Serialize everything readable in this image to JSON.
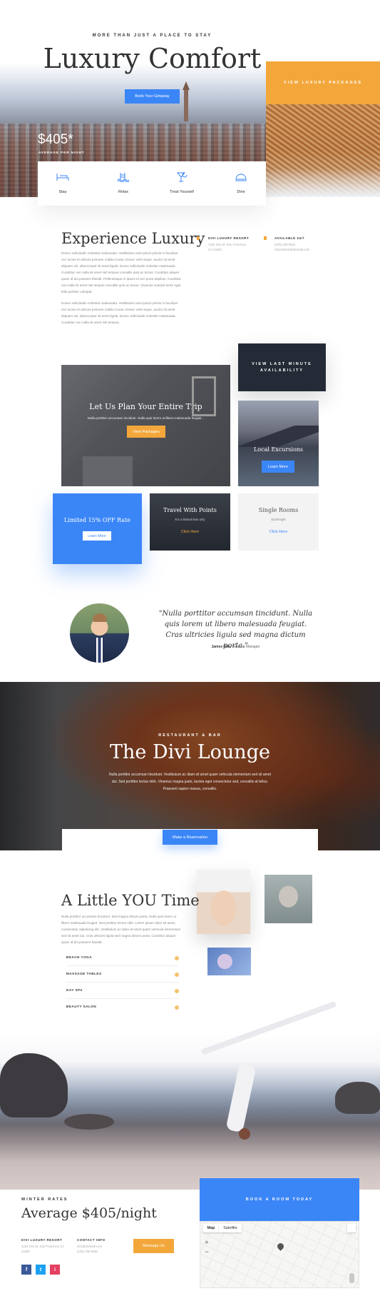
{
  "hero": {
    "eyebrow": "MORE THAN JUST A PLACE TO STAY",
    "title": "Luxury Comfort",
    "cta": "Book Your Getaway",
    "side_button": "VIEW LUXURY PACKAGES",
    "price": "$405*",
    "price_note": "AVERAGE PER NIGHT"
  },
  "amenities": [
    {
      "label": "Stay",
      "icon": "bed-icon"
    },
    {
      "label": "Relax",
      "icon": "pool-icon"
    },
    {
      "label": "Treat Yourself",
      "icon": "cocktail-icon"
    },
    {
      "label": "Dine",
      "icon": "cloche-icon"
    }
  ],
  "experience": {
    "title": "Experience Luxury",
    "para1": "Donec sollicitudin molestie malesuada. Vestibulum ante ipsum primis in faucibus orci luctus et ultrices posuere cubilia Curae; Donec velit neque, auctor sit amet aliquam vel, ullamcorper sit amet ligula. Donec sollicitudin molestie malesuada. Curabitur non nulla sit amet nisl tempus convallis quis ac lectus. Curabitur aliquet quam id dui posuere blandit. Pellentesque in ipsum id orci porta dapibus. Curabitur non nulla sit amet nisl tempus convallis quis ac lectus. Vivamus suscipit tortor eget felis porttitor volutpat.",
    "para2": "Donec sollicitudin molestie malesuada. Vestibulum ante ipsum primis in faucibus orci luctus et ultrices posuere cubilia Curae; Donec velit neque, auctor sit amet aliquam vel, ullamcorper sit amet ligula. Donec sollicitudin molestie malesuada. Curabitur non nulla sit amet nisl tempus.",
    "resort_label": "DIVI LUXURY RESORT",
    "resort_addr": "1234 Divi St. San Francisco, CA 23452",
    "avail_label": "AVAILABLE 24/7",
    "avail_phone": "(235) 235-9521",
    "avail_email": "information@divimail.com"
  },
  "grid": {
    "plan_title": "Let Us Plan Your Entire Trip",
    "plan_text": "Nulla porttitor accumsan tincidunt. Nulla quis lorem ut libero malesuada feugiat...",
    "plan_button": "View Packages",
    "last_minute": "VIEW LAST MINUTE AVAILABILITY",
    "excursion_title": "Local Excursions",
    "excursion_button": "Learn More",
    "rate_title": "Limited 15% OFF Rate",
    "rate_button": "Learn More",
    "points_title": "Travel With Points",
    "points_text": "For a limited time only",
    "points_link": "Click Here",
    "rooms_title": "Single Rooms",
    "rooms_price": "$100/night",
    "rooms_link": "Click Here"
  },
  "testimonial": {
    "quote": "\"Nulla porttitor accumsan tincidunt. Nulla quis lorem ut libero malesuada feugiat. Cras ultricies ligula sed magna dictum porta.\"",
    "name": "James Doe,",
    "role": "General Manager"
  },
  "lounge": {
    "eyebrow": "RESTAURANT & BAR",
    "title": "The Divi Lounge",
    "text": "Nulla porttitor accumsan tincidunt. Vestibulum ac diam sit amet quam vehicula elementum sed sit amet dui. Sed porttitor lectus nibh. Vivamus magna justo, lacinia eget consectetur sed, convallis at tellus. Praesent sapien massa, convallis.",
    "button": "Make a Reservation"
  },
  "you_time": {
    "title": "A Little YOU Time",
    "text": "Nulla porttitor accumsan tincidunt. Sed magna dictum porta. Nulla quis lorem ut libero malesuada feugiat. Sed porttitor lectus nibh. Lorem ipsum dolor sit amet, consectetur adipiscing elit. Vestibulum ac diam sit amet quam vehicula elementum sed sit amet dui. Cras ultricies ligula sed magna dictum porta. Curabitur aliquet quam id dui posuere blandit.",
    "items": [
      "BEACH YOGA",
      "MASSAGE TABLES",
      "DAY SPA",
      "BEAUTY SALON"
    ]
  },
  "footer": {
    "eyebrow": "WINTER RATES",
    "title": "Average $405/night",
    "resort_label": "DIVI LUXURY RESORT",
    "resort_addr": "1234 Divi St. San Francisco CA 23452",
    "contact_label": "CONTACT INFO",
    "contact_email": "info@divimail.com",
    "contact_phone": "(235) 325-5652",
    "message_button": "Message Us",
    "book_button": "BOOK A ROOM TODAY",
    "map_tab_map": "Map",
    "map_tab_sat": "Satellite",
    "social": [
      "f",
      "t",
      "i"
    ]
  },
  "colors": {
    "accent_blue": "#3b86f7",
    "accent_orange": "#f3a73b",
    "dark": "#252b36"
  }
}
